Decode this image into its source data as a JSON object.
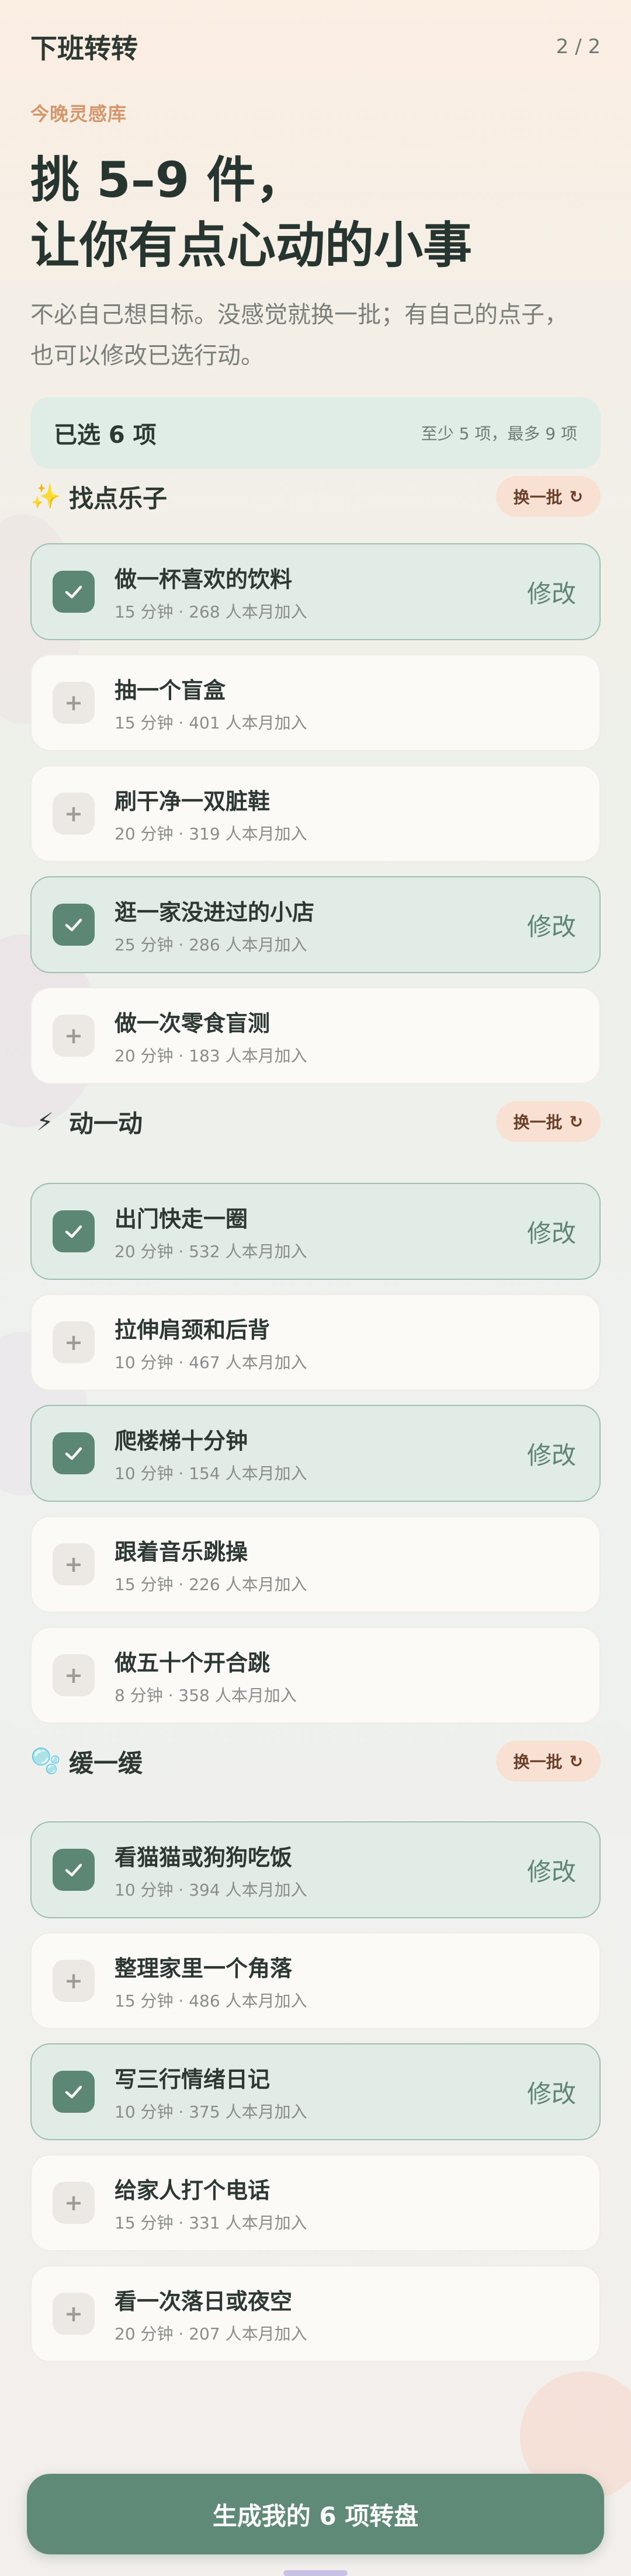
{
  "header": {
    "title": "下班转转",
    "page_indicator": "2 / 2"
  },
  "hero": {
    "eyebrow": "今晚灵感库",
    "headline_line1": "挑 5–9 件，",
    "headline_line2": "让你有点心动的小事",
    "subtitle_line1": "不必自己想目标。没感觉就换一批；有自己的点子，",
    "subtitle_line2": "也可以修改已选行动。"
  },
  "selected": {
    "count_label": "已选 6 项",
    "rule": "至少 5 项，最多 9 项"
  },
  "sections": [
    {
      "icon": "✨",
      "icon_name": "sparkles-icon",
      "title": "找点乐子",
      "swap_label": "换一批",
      "items": [
        {
          "title": "做一杯喜欢的饮料",
          "meta": "15 分钟 · 268 人本月加入",
          "selected": true,
          "action": "修改"
        },
        {
          "title": "抽一个盲盒",
          "meta": "15 分钟 · 401 人本月加入",
          "selected": false
        },
        {
          "title": "刷干净一双脏鞋",
          "meta": "20 分钟 · 319 人本月加入",
          "selected": false
        },
        {
          "title": "逛一家没进过的小店",
          "meta": "25 分钟 · 286 人本月加入",
          "selected": true,
          "action": "修改"
        },
        {
          "title": "做一次零食盲测",
          "meta": "20 分钟 · 183 人本月加入",
          "selected": false
        }
      ]
    },
    {
      "icon": "⚡",
      "icon_name": "lightning-icon",
      "title": "动一动",
      "swap_label": "换一批",
      "items": [
        {
          "title": "出门快走一圈",
          "meta": "20 分钟 · 532 人本月加入",
          "selected": true,
          "action": "修改"
        },
        {
          "title": "拉伸肩颈和后背",
          "meta": "10 分钟 · 467 人本月加入",
          "selected": false
        },
        {
          "title": "爬楼梯十分钟",
          "meta": "10 分钟 · 154 人本月加入",
          "selected": true,
          "action": "修改"
        },
        {
          "title": "跟着音乐跳操",
          "meta": "15 分钟 · 226 人本月加入",
          "selected": false
        },
        {
          "title": "做五十个开合跳",
          "meta": "8 分钟 · 358 人本月加入",
          "selected": false
        }
      ]
    },
    {
      "icon": "🫧",
      "icon_name": "bubbles-icon",
      "title": "缓一缓",
      "swap_label": "换一批",
      "items": [
        {
          "title": "看猫猫或狗狗吃饭",
          "meta": "10 分钟 · 394 人本月加入",
          "selected": true,
          "action": "修改"
        },
        {
          "title": "整理家里一个角落",
          "meta": "15 分钟 · 486 人本月加入",
          "selected": false
        },
        {
          "title": "写三行情绪日记",
          "meta": "10 分钟 · 375 人本月加入",
          "selected": true,
          "action": "修改"
        },
        {
          "title": "给家人打个电话",
          "meta": "15 分钟 · 331 人本月加入",
          "selected": false
        },
        {
          "title": "看一次落日或夜空",
          "meta": "20 分钟 · 207 人本月加入",
          "selected": false
        }
      ]
    }
  ],
  "cta": {
    "label": "生成我的 6 项转盘"
  },
  "colors": {
    "accent": "#5f8a77",
    "selected_bg": "#e0ece5",
    "swap_bg": "#f8e1d2"
  }
}
